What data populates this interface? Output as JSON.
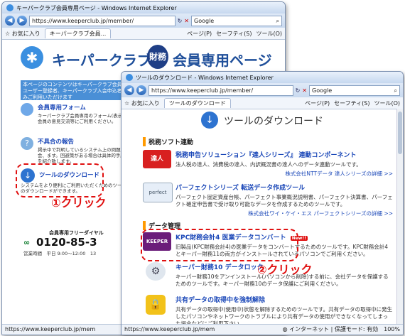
{
  "back_window": {
    "title": "キーパークラブ会員専用ページ - Windows Internet Explorer",
    "url": "https://www.keeperclub.jp/member/",
    "search_placeholder": "Google",
    "favorites_label": "お気に入り",
    "tab_label": "キーパークラブ会員...",
    "cmd_items": [
      "ページ(P)",
      "セーフティ(S)",
      "ツール(O)"
    ],
    "header_left": "キーパークラブ",
    "header_badge": "財務",
    "header_right": "会員専用ページ",
    "notice": "本ページのコンテンツはキーパークラブ会員のユーザー登録者、キーパークラブ入会申込者のみご利用いただけます",
    "items": [
      {
        "title": "会員専用フォーム",
        "desc": "キーパークラブ会員専用のフォーム(表示順会員の意見交流等にご利用ください。"
      },
      {
        "title": "不具合の報告",
        "desc": "掲示中で判明しているシステム上の問題の会、ます。回避策がある場合は具体的手順を紹介致します。"
      },
      {
        "title": "ツールのダウンロード",
        "desc": "システムをより便利にご利用いただくためのツールのダウンロードができます。"
      }
    ],
    "freedial_label": "会員専用フリーダイヤル",
    "freedial_number": "0120-85-3",
    "hours": "営業時間　平日 9:00～12:00　13",
    "status_url": "https://www.keeperclub.jp/mem"
  },
  "front_window": {
    "title": "ツールのダウンロード - Windows Internet Explorer",
    "url": "https://www.keeperclub.jp/member/",
    "search_placeholder": "Google",
    "favorites_label": "お気に入り",
    "tab_label": "ツールのダウンロード",
    "cmd_items": [
      "ページ(P)",
      "セーフティ(S)",
      "ツール(O)"
    ],
    "page_title": "ツールのダウンロード",
    "section1": "税務ソフト連動",
    "section2": "データ管理",
    "items": [
      {
        "title": "税務申告ソリューション『達人シリーズ』 連動コンポーネント",
        "desc": "法人税の達人、消費税の達人、内訳概況書の達人へのデータ連動ツールです。",
        "more": "株式会社NTTデータ 達人シリーズの詳細 >>"
      },
      {
        "title": "パーフェクトシリーズ 転送データ作成ツール",
        "desc": "パーフェクト固定資産台帳、パーフェクト事業概況説明書、パーフェクト決算書、パーフェクト確定申告書で受け取り可能なデータを作成するためのツールです。",
        "more": "株式会社ワイ・ケイ・エス パーフェクトシリーズの詳細 >>"
      },
      {
        "title": "KPC財務会計4 医業データコンバート",
        "badge": "New!!",
        "desc": "旧製品(KPC財務会計4)の医業データをコンバートするためのツールです。KPC財務会計4とキーパー財務11の両方がインストールされているパソコンでご利用ください。"
      },
      {
        "title": "キーパー財務10 データロック",
        "desc": "キーパー財務10をアンインストール(パソコンから削除)する前に、会社データを保護するためのツールです。キーパー財務10のデータ保護にご利用ください。"
      },
      {
        "title": "共有データの取得中を強制解除",
        "desc": "共有データの取得中(使用中)状態を解除するためのツールです。共有データの取得中に発生したパソコンやネットワークのトラブルにより共有データの使用ができなくなってしまった場合などにご利用下さい。"
      }
    ],
    "status_url": "https://www.keeperclub.jp/mem",
    "status_zone": "インターネット | 保護モード: 有効",
    "zoom": "100%"
  },
  "annotations": {
    "click1": "①クリック",
    "click2": "②クリック"
  },
  "colors": {
    "accent_red": "#e01010",
    "link": "#1a47b8",
    "header_blue": "#3a8fe0"
  }
}
